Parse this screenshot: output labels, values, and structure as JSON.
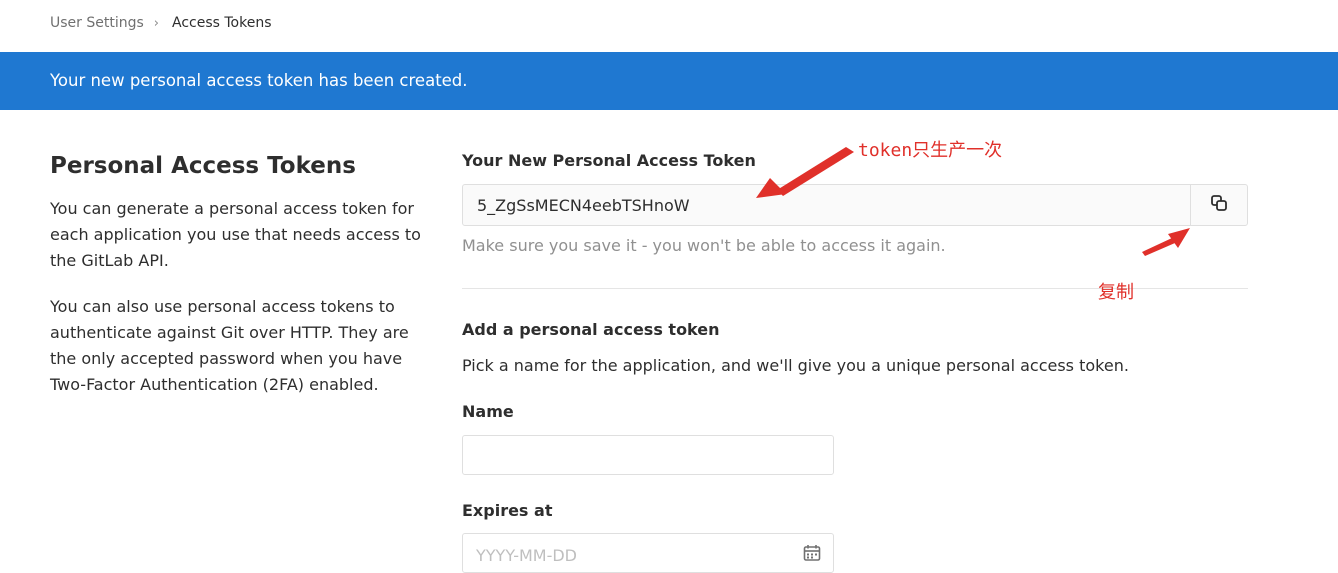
{
  "breadcrumb": {
    "parent": "User Settings",
    "separator": "›",
    "current": "Access Tokens"
  },
  "banner": {
    "message": "Your new personal access token has been created.",
    "color": "#1f78d1"
  },
  "left": {
    "title": "Personal Access Tokens",
    "paragraph1": "You can generate a personal access token for each application you use that needs access to the GitLab API.",
    "paragraph2": "You can also use personal access tokens to authenticate against Git over HTTP. They are the only accepted password when you have Two-Factor Authentication (2FA) enabled."
  },
  "new_token": {
    "label": "Your New Personal Access Token",
    "value": "5_ZgSsMECN4eebTSHnoW",
    "copy_icon": "copy-icon",
    "help": "Make sure you save it - you won't be able to access it again."
  },
  "add_token": {
    "heading": "Add a personal access token",
    "description": "Pick a name for the application, and we'll give you a unique personal access token.",
    "name_label": "Name",
    "name_value": "",
    "expires_label": "Expires at",
    "expires_placeholder": "YYYY-MM-DD",
    "calendar_icon": "calendar-icon"
  },
  "annotations": {
    "token_note": "token只生产一次",
    "copy_note": "复制",
    "color": "#e0302a"
  }
}
